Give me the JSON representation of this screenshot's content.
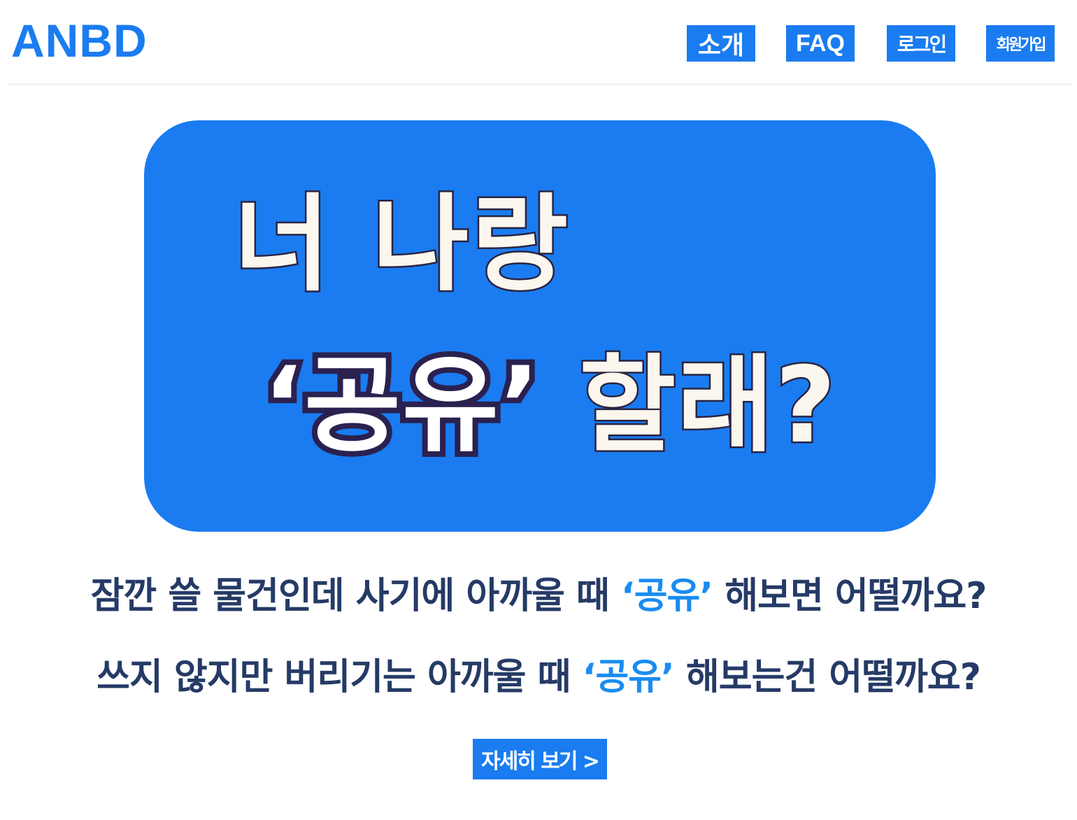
{
  "header": {
    "logo": "ANBD",
    "nav": {
      "intro": "소개",
      "faq": "FAQ",
      "login": "로그인",
      "signup": "회원가입"
    }
  },
  "banner": {
    "line1": "너 나랑",
    "line2_emphasis": "‘공유’",
    "line2_rest": " 할래?"
  },
  "description": {
    "line1_before": "잠깐 쓸 물건인데 사기에 아까울 때 ",
    "line1_highlight": "‘공유’",
    "line1_after": " 해보면 어떨까요?",
    "line2_before": "쓰지 않지만 버리기는 아까울 때 ",
    "line2_highlight": "‘공유’",
    "line2_after": " 해보는건 어떨까요?"
  },
  "cta": {
    "label": "자세히 보기 >"
  },
  "colors": {
    "brand_blue": "#1a7cf0",
    "highlight_blue": "#1a8cf0",
    "text_navy": "#253a66",
    "banner_outline": "#2a2150",
    "banner_text": "#fbf7ee"
  }
}
